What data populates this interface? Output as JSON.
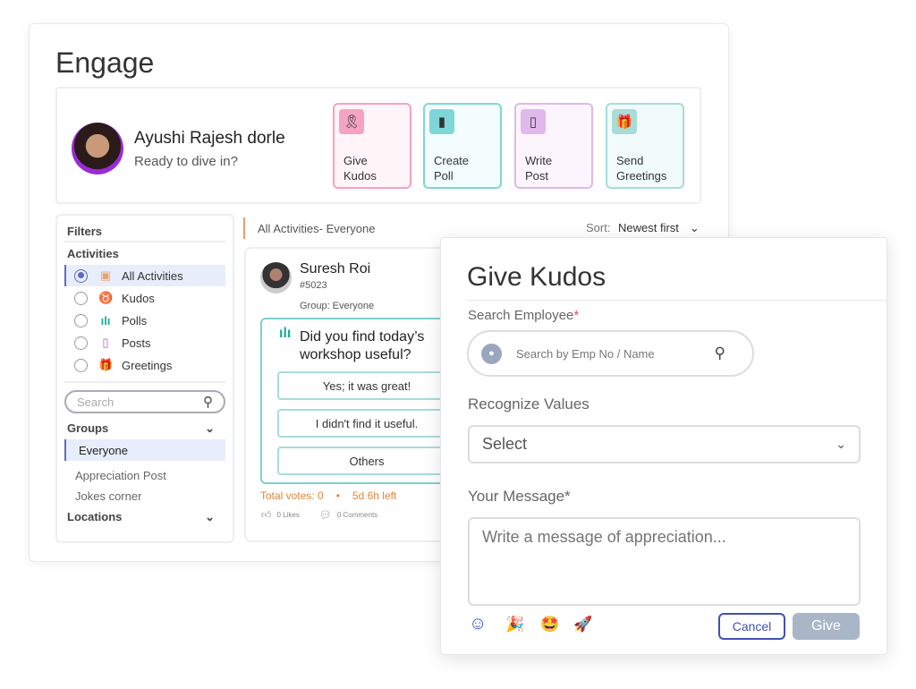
{
  "page": {
    "title": "Engage"
  },
  "profile": {
    "name": "Ayushi Rajesh dorle",
    "subtitle": "Ready to dive in?"
  },
  "actions": [
    {
      "label": "Give\nKudos",
      "icon": "ribbon-icon",
      "color": "#f4a3c0",
      "bg": "#fff5f8"
    },
    {
      "label": "Create\nPoll",
      "icon": "poll-chart-icon",
      "color": "#7fd6d8",
      "bg": "#f3fdfd"
    },
    {
      "label": "Write\nPost",
      "icon": "document-icon",
      "color": "#e0b8ec",
      "bg": "#fcf5fe"
    },
    {
      "label": "Send\nGreetings",
      "icon": "gift-icon",
      "color": "#a8dcd8",
      "bg": "#f2fbfb"
    }
  ],
  "filters": {
    "title": "Filters",
    "activities_label": "Activities",
    "activities": [
      {
        "label": "All Activities",
        "icon": "grid-icon",
        "selected": true
      },
      {
        "label": "Kudos",
        "icon": "ribbon-icon",
        "selected": false
      },
      {
        "label": "Polls",
        "icon": "poll-chart-icon",
        "selected": false
      },
      {
        "label": "Posts",
        "icon": "document-icon",
        "selected": false
      },
      {
        "label": "Greetings",
        "icon": "gift-icon",
        "selected": false
      }
    ],
    "search_placeholder": "Search",
    "groups_label": "Groups",
    "groups": [
      "Everyone",
      "Appreciation Post",
      "Jokes corner"
    ],
    "locations_label": "Locations"
  },
  "feed": {
    "heading": "All Activities- Everyone",
    "sort_label": "Sort:",
    "sort_value": "Newest first"
  },
  "post": {
    "author": "Suresh Roi",
    "emp_no": "#5023",
    "group": "Group: Everyone",
    "question": "Did you find today’s workshop useful?",
    "options": [
      "Yes; it was great!",
      "I didn't find it useful.",
      "Others"
    ],
    "total_votes": "Total votes: 0",
    "time_left": "5d 6h left",
    "likes": "0 Likes",
    "comments": "0 Comments"
  },
  "modal": {
    "title": "Give Kudos",
    "search_label": "Search Employee",
    "required": "*",
    "search_placeholder": "Search by Emp No / Name",
    "values_label": "Recognize Values",
    "values_selected": "Select",
    "message_label": "Your Message*",
    "message_placeholder": "Write a message of appreciation...",
    "emojis": [
      "🎉",
      "🤩",
      "🚀"
    ],
    "cancel": "Cancel",
    "give": "Give"
  }
}
